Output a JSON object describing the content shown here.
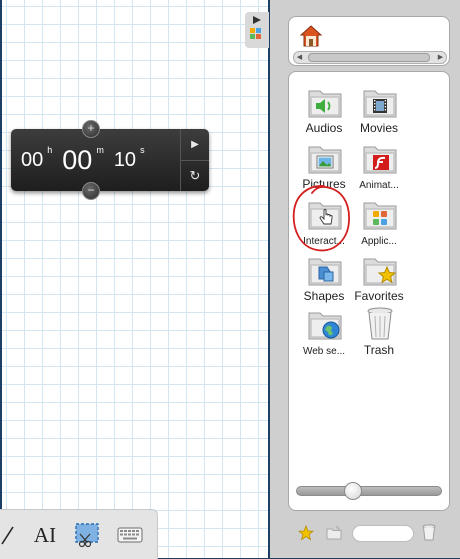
{
  "timer": {
    "hours": "00",
    "hours_unit": "h",
    "minutes": "00",
    "minutes_unit": "m",
    "seconds": "10",
    "seconds_unit": "s",
    "plus": "+",
    "minus": "−",
    "play": "▶",
    "reset": "↻"
  },
  "toolbar": {
    "text_tool": "AI",
    "icons": [
      "line-tool-icon",
      "text-tool-icon",
      "screen-capture-icon",
      "keyboard-icon"
    ]
  },
  "library": {
    "scroll_left": "◀",
    "scroll_right": "▶",
    "items": [
      {
        "label": "Audios",
        "icon": "audio-folder-icon"
      },
      {
        "label": "Movies",
        "icon": "movie-folder-icon"
      },
      {
        "label": "Pictures",
        "icon": "pictures-folder-icon"
      },
      {
        "label": "Animat...",
        "icon": "animations-folder-icon"
      },
      {
        "label": "Interact...",
        "icon": "interactive-folder-icon"
      },
      {
        "label": "Applic...",
        "icon": "applications-folder-icon"
      },
      {
        "label": "Shapes",
        "icon": "shapes-folder-icon"
      },
      {
        "label": "Favorites",
        "icon": "favorites-folder-icon"
      },
      {
        "label": "Web se...",
        "icon": "web-search-folder-icon"
      },
      {
        "label": "Trash",
        "icon": "trash-icon"
      }
    ],
    "zoom_slider_value": 0.37
  },
  "colors": {
    "background": "#1d3f63",
    "grid_line": "#d4e6f2",
    "annotation": "#d41f1f",
    "star": "#f2c200"
  }
}
